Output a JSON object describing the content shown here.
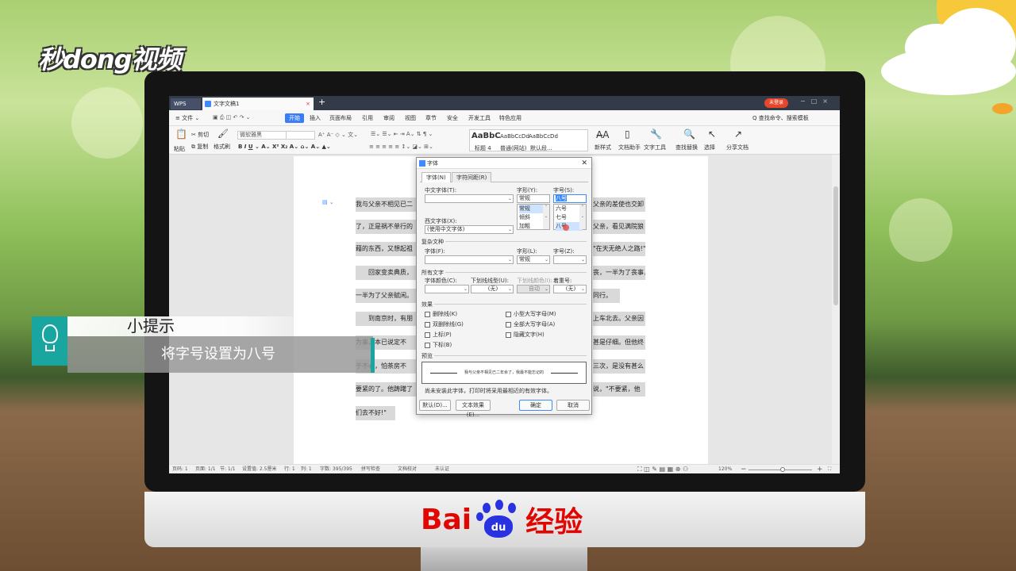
{
  "overlay": {
    "logo_text": "秒dong视频",
    "tip_title": "小提示",
    "tip_body": "将字号设置为八号",
    "baidu_left": "Bai",
    "baidu_paw": "du",
    "baidu_right": "经验"
  },
  "window": {
    "app_tab": "WPS",
    "doc_tab": "文字文稿1",
    "login_label": "未登录"
  },
  "menu": {
    "file": "≡ 文件 ⌄",
    "items": [
      "开始",
      "插入",
      "页面布局",
      "引用",
      "审阅",
      "视图",
      "章节",
      "安全",
      "开发工具",
      "特色应用"
    ],
    "search_hint": "Q 查找命令、搜索模板"
  },
  "ribbon": {
    "paste": "粘贴",
    "cut": "剪切",
    "copy": "复制",
    "format_painter": "格式刷",
    "font_name": "微软雅黑",
    "styles": [
      {
        "preview": "AaBbC",
        "name": "标题 4"
      },
      {
        "preview": "AaBbCcDd",
        "name": "普通(网站)"
      },
      {
        "preview": "AaBbCcDd",
        "name": "默认段..."
      }
    ],
    "new_style": "新样式",
    "doc_assistant": "文档助手",
    "text_tools": "文字工具",
    "find_replace": "查找替换",
    "select": "选择",
    "share": "分享文档"
  },
  "document": {
    "paragraphs": [
      "我与父亲不相见已二",
      "了，正是祸不单行的",
      "藉的东西，又想起祖",
      "　　回家变卖典质，",
      "一半为了父亲赋闲。",
      "　　到南京时，有朋",
      "为事，本已说定不",
      "于不心，怕茶房不",
      "要紧的了。他踌躇了",
      "们去不好!\""
    ],
    "right_fragments": [
      "父亲的差使也交卸",
      "父亲，看见满院狼",
      "\"在天无绝人之路!\"",
      "丧，一半为了丧事，",
      "同行。",
      "上车北去。父亲因",
      "甚是仔细。但他终",
      "三次，是没有甚么",
      "说，\"不要紧，他"
    ]
  },
  "dialog": {
    "title": "字体",
    "tabs": [
      "字体(N)",
      "字符间距(R)"
    ],
    "cn_font_label": "中文字体(T):",
    "cn_font_value": "",
    "style_label": "字形(Y):",
    "style_value": "常规",
    "style_options": [
      "常规",
      "倾斜",
      "加粗"
    ],
    "size_label": "字号(S):",
    "size_value": "八号",
    "size_options": [
      "六号",
      "七号",
      "八号"
    ],
    "west_font_label": "西文字体(X):",
    "west_font_value": "(使用中文字体)",
    "complex_section": "复杂文种",
    "complex_font_label": "字体(F):",
    "complex_style_label": "字形(L):",
    "complex_style_value": "常规",
    "complex_size_label": "字号(Z):",
    "all_text_section": "所有文字",
    "color_label": "字体颜色(C):",
    "underline_label": "下划线线型(U):",
    "underline_value": "(无)",
    "underline_color_label": "下划线颜色(I):",
    "underline_color_value": "自动",
    "emphasis_label": "着重号:",
    "emphasis_value": "(无)",
    "effects_section": "效果",
    "effects": [
      "删除线(K)",
      "双删除线(G)",
      "上标(P)",
      "下标(B)",
      "小型大写字母(M)",
      "全部大写字母(A)",
      "隐藏文字(H)"
    ],
    "preview_section": "预览",
    "preview_text": "我与父亲不相见已二年余了，我最不能忘记的",
    "note": "尚未安装此字体，打印时将采用最相近的有效字体。",
    "buttons": {
      "default": "默认(D)...",
      "text_effects": "文本效果(E)...",
      "ok": "确定",
      "cancel": "取消"
    }
  },
  "status": {
    "page": "页码: 1",
    "pages": "页面: 1/1",
    "section": "节: 1/1",
    "position": "设置值: 2.5厘米",
    "row": "行: 1",
    "col": "列: 1",
    "word_count": "字数: 395/395",
    "spell": "拼写检查",
    "proof": "文档校对",
    "cert": "未认证",
    "zoom": "120%"
  }
}
